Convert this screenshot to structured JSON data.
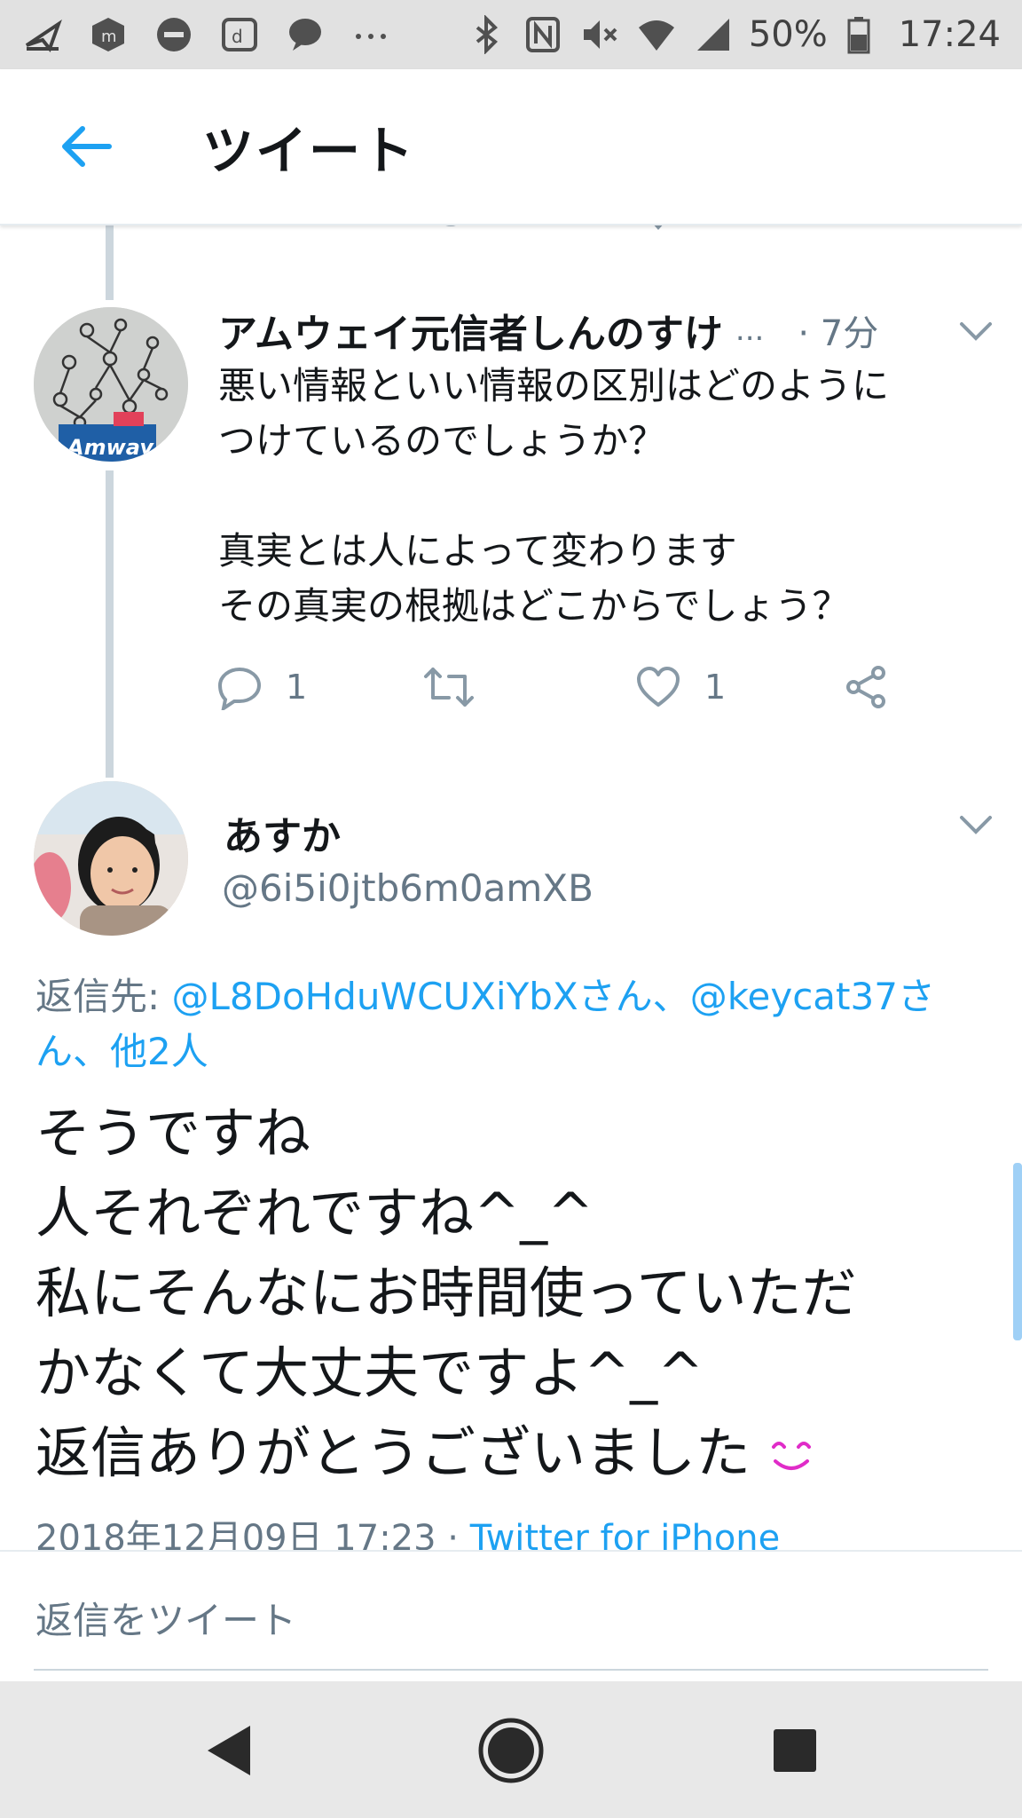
{
  "status_bar": {
    "battery": "50%",
    "time": "17:24",
    "icons": [
      "paper-plane-icon",
      "mcafee-icon",
      "do-not-disturb-icon",
      "d-app-icon",
      "chat-bubble-icon",
      "more-icon",
      "bluetooth-icon",
      "nfc-icon",
      "mute-icon",
      "wifi-icon",
      "signal-icon",
      "battery-icon"
    ]
  },
  "header": {
    "title": "ツイート",
    "back_icon": "back-arrow-icon",
    "accent_color": "#1da1f2"
  },
  "tweet_parent": {
    "name": "アムウェイ元信者しんのすけ",
    "name_ellipsis": "...",
    "time": "· 7分",
    "body": "悪い情報といい情報の区別はどのように\nつけているのでしょうか？\n\n真実とは人によって変わります\nその真実の根拠はどこからでしょう？",
    "avatar_text": "Amway",
    "reply_count": "1",
    "like_count": "1"
  },
  "tweet_main": {
    "name": "あすか",
    "handle": "@6i5i0jtb6m0amXB",
    "reply_prefix": "返信先: ",
    "reply_link_1": "@L8DoHduWCUXiYbXさん",
    "reply_sep": "、",
    "reply_link_2": "@keycat37さん",
    "reply_sep_2": "、",
    "reply_others": "他2人",
    "body": "そうですね\n人それぞれですね^_^\n私にそんなにお時間使っていただ\nかなくて大丈夫ですよ^_^\n返信ありがとうございました",
    "timestamp": "2018年12月09日 17:23",
    "meta_sep": " · ",
    "source": "Twitter for iPhone"
  },
  "reply_bar": {
    "placeholder": "返信をツイート"
  }
}
